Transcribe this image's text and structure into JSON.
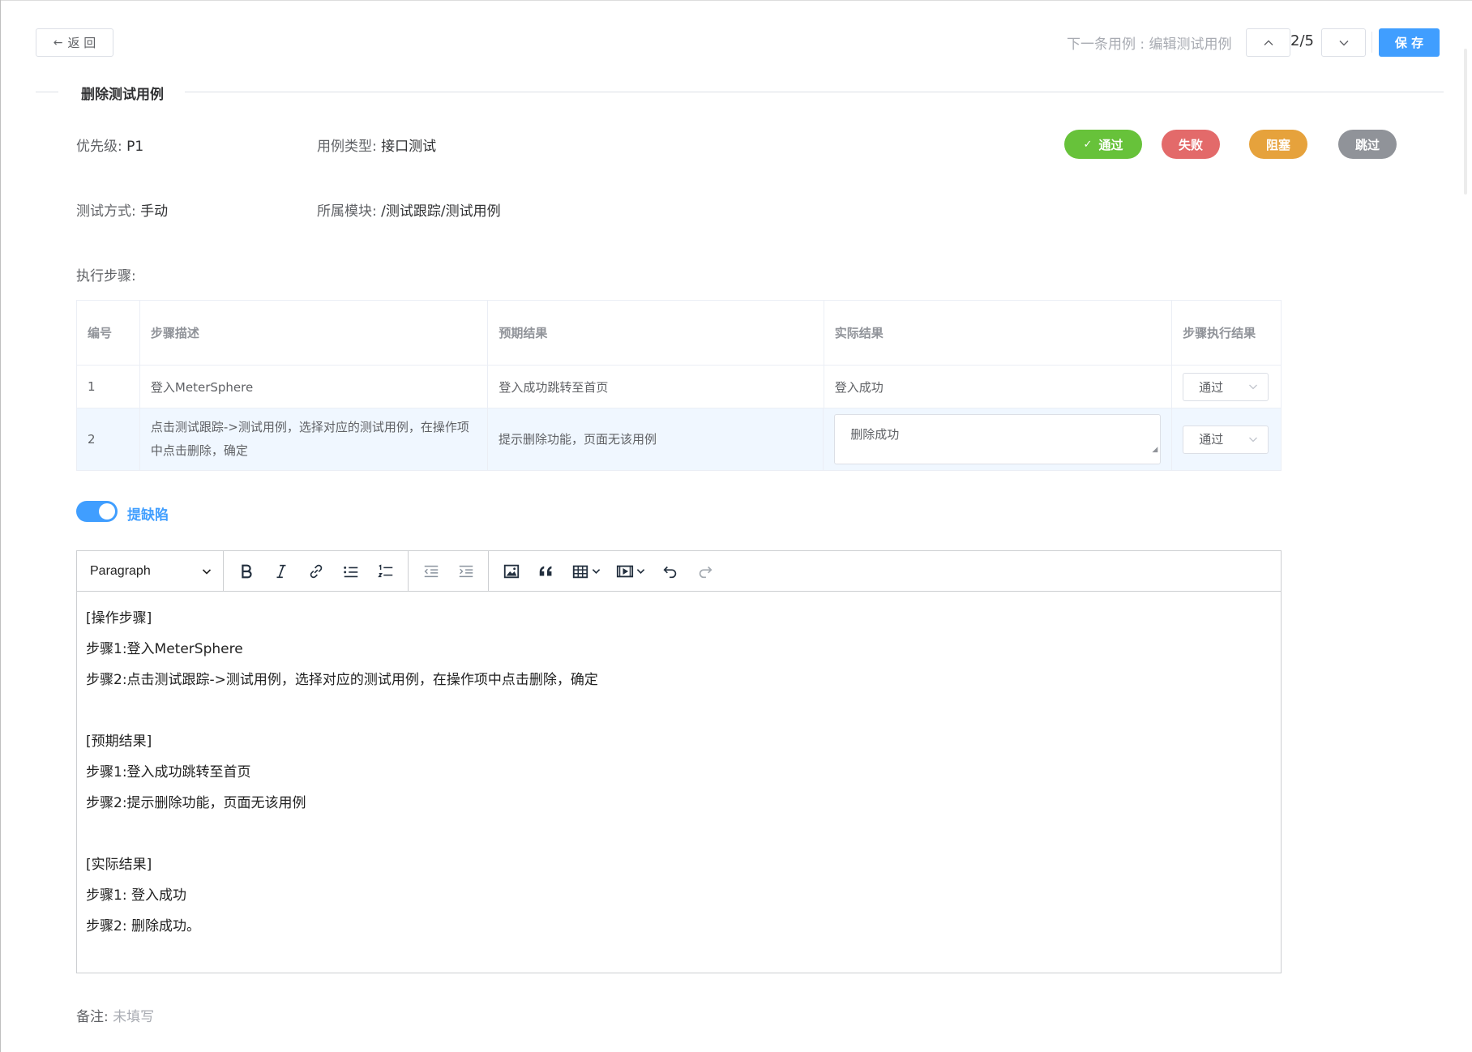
{
  "header": {
    "back_label": "返 回",
    "next_label": "下一条用例 : 编辑测试用例",
    "page_count": "2/5",
    "save_label": "保 存"
  },
  "case": {
    "title": "删除测试用例",
    "priority_label": "优先级:",
    "priority_value": "P1",
    "type_label": "用例类型:",
    "type_value": "接口测试",
    "method_label": "测试方式:",
    "method_value": "手动",
    "module_label": "所属模块:",
    "module_value": "/测试跟踪/测试用例"
  },
  "status_buttons": {
    "pass": "通过",
    "fail": "失败",
    "blocked": "阻塞",
    "skip": "跳过"
  },
  "steps": {
    "label": "执行步骤:",
    "columns": [
      "编号",
      "步骤描述",
      "预期结果",
      "实际结果",
      "步骤执行结果"
    ],
    "rows": [
      {
        "num": "1",
        "desc": "登入MeterSphere",
        "expected": "登入成功跳转至首页",
        "actual": "登入成功",
        "result": "通过"
      },
      {
        "num": "2",
        "desc": "点击测试跟踪->测试用例，选择对应的测试用例，在操作项中点击删除，确定",
        "expected": "提示删除功能，页面无该用例",
        "actual": "删除成功",
        "result": "通过"
      }
    ]
  },
  "defect": {
    "toggle_label": "提缺陷",
    "toggle_on": true
  },
  "editor": {
    "block_format": "Paragraph",
    "lines": {
      "l1": "[操作步骤]",
      "l2": "步骤1:登入MeterSphere",
      "l3": "步骤2:点击测试跟踪->测试用例，选择对应的测试用例，在操作项中点击删除，确定",
      "l4": "[预期结果]",
      "l5": "步骤1:登入成功跳转至首页",
      "l6": "步骤2:提示删除功能，页面无该用例",
      "l7": "[实际结果]",
      "l8": "步骤1: 登入成功",
      "l9": "步骤2: 删除成功。"
    }
  },
  "notes": {
    "label": "备注:",
    "placeholder": "未填写"
  },
  "colors": {
    "primary": "#409eff",
    "pass": "#67c23a",
    "fail": "#e36a6a",
    "blocked": "#e6a23c",
    "skip": "#909399"
  }
}
